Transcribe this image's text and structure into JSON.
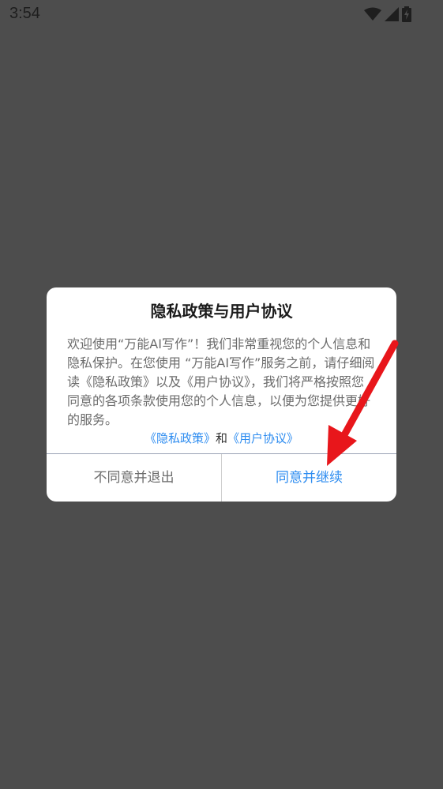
{
  "status_bar": {
    "time": "3:54",
    "icons": [
      "wifi-icon",
      "signal-icon",
      "battery-charging-icon"
    ]
  },
  "dialog": {
    "title": "隐私政策与用户协议",
    "body": "欢迎使用“万能AI写作”！我们非常重视您的个人信息和隐私保护。在您使用 “万能AI写作”服务之前，请仔细阅读《隐私政策》以及《用户协议》，我们将严格按照您同意的各项条款使用您的个人信息，以便为您提供更好的服务。",
    "privacy_link": "《隐私政策》",
    "and_text": "和",
    "terms_link": "《用户协议》",
    "decline_button": "不同意并退出",
    "accept_button": "同意并继续"
  },
  "colors": {
    "backdrop": "#4d4d4d",
    "link": "#2d8cf0",
    "arrow": "#e8161b"
  }
}
